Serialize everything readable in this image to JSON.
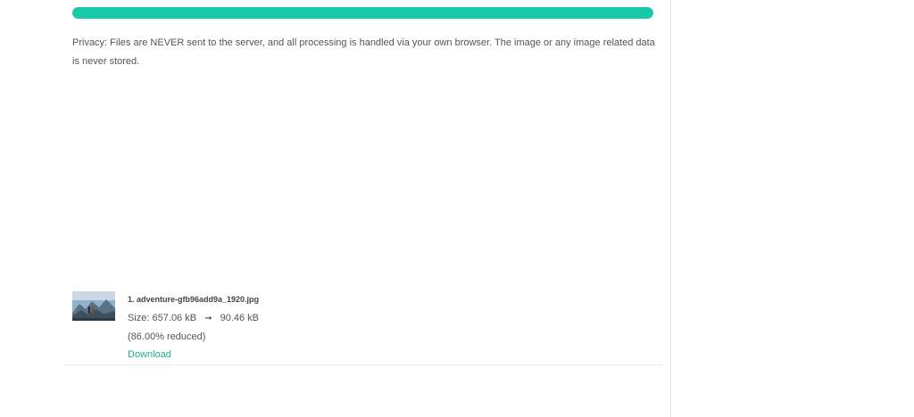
{
  "progress": {
    "percent": 100,
    "color": "#17c9a7"
  },
  "privacy": {
    "text": "Privacy: Files are NEVER sent to the server, and all processing is handled via your own browser. The image or any image related data is never stored."
  },
  "result": {
    "file_name": "1. adventure-gfb96add9a_1920.jpg",
    "size_label": "Size:",
    "original_size": "657.06 kB",
    "compressed_size": "90.46 kB",
    "reduced_text": "(86.00% reduced)",
    "download_label": "Download",
    "thumbnail_icon": "mountain-photo-thumbnail"
  },
  "accent_color": "#17b38f"
}
